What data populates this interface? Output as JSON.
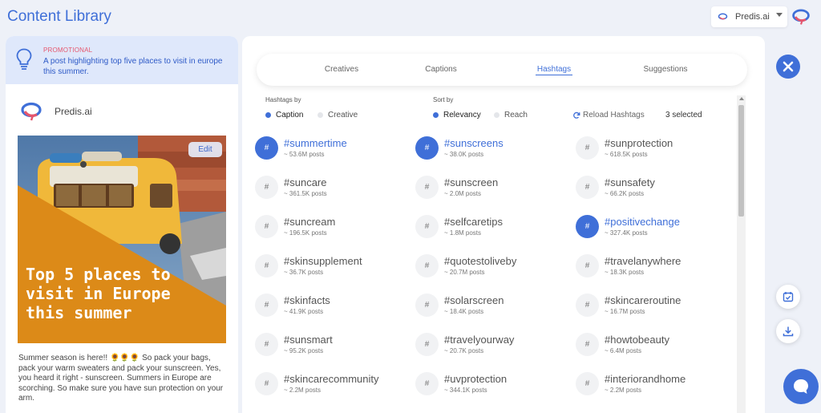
{
  "app": {
    "title": "Content Library"
  },
  "account": {
    "name": "Predis.ai"
  },
  "prompt": {
    "tag": "PROMOTIONAL",
    "text": "A post highlighting top five places to visit in europe this summer."
  },
  "post": {
    "brand": "Predis.ai",
    "headline_lines": [
      "Top 5 places to",
      "visit in Europe",
      "this summer"
    ],
    "edit_label": "Edit",
    "caption_before": "Summer season is here!! ",
    "caption_emoji": "🌻🌻🌻",
    "caption_after": " So pack your bags, pack your warm sweaters and pack your sunscreen. Yes, you heard it right - sunscreen. Summers in Europe are scorching. So make sure you have sun protection on your arm."
  },
  "tabs": [
    {
      "label": "Creatives",
      "active": false
    },
    {
      "label": "Captions",
      "active": false
    },
    {
      "label": "Hashtags",
      "active": true
    },
    {
      "label": "Suggestions",
      "active": false
    }
  ],
  "options": {
    "hashtags_by_label": "Hashtags by",
    "hashtags_by": [
      {
        "label": "Caption",
        "selected": true
      },
      {
        "label": "Creative",
        "selected": false
      }
    ],
    "sort_by_label": "Sort by",
    "sort_by": [
      {
        "label": "Relevancy",
        "selected": true
      },
      {
        "label": "Reach",
        "selected": false
      }
    ],
    "reload_label": "Reload Hashtags",
    "selected_count": "3 selected"
  },
  "hashtags": [
    {
      "tag": "#summertime",
      "posts": "~ 53.6M posts",
      "selected": true
    },
    {
      "tag": "#sunscreens",
      "posts": "~ 38.0K posts",
      "selected": true
    },
    {
      "tag": "#sunprotection",
      "posts": "~ 618.5K posts",
      "selected": false
    },
    {
      "tag": "#suncare",
      "posts": "~ 361.5K posts",
      "selected": false
    },
    {
      "tag": "#sunscreen",
      "posts": "~ 2.0M posts",
      "selected": false
    },
    {
      "tag": "#sunsafety",
      "posts": "~ 66.2K posts",
      "selected": false
    },
    {
      "tag": "#suncream",
      "posts": "~ 196.5K posts",
      "selected": false
    },
    {
      "tag": "#selfcaretips",
      "posts": "~ 1.8M posts",
      "selected": false
    },
    {
      "tag": "#positivechange",
      "posts": "~ 327.4K posts",
      "selected": true
    },
    {
      "tag": "#skinsupplement",
      "posts": "~ 36.7K posts",
      "selected": false
    },
    {
      "tag": "#quotestoliveby",
      "posts": "~ 20.7M posts",
      "selected": false
    },
    {
      "tag": "#travelanywhere",
      "posts": "~ 18.3K posts",
      "selected": false
    },
    {
      "tag": "#skinfacts",
      "posts": "~ 41.9K posts",
      "selected": false
    },
    {
      "tag": "#solarscreen",
      "posts": "~ 18.4K posts",
      "selected": false
    },
    {
      "tag": "#skincareroutine",
      "posts": "~ 16.7M posts",
      "selected": false
    },
    {
      "tag": "#sunsmart",
      "posts": "~ 95.2K posts",
      "selected": false
    },
    {
      "tag": "#travelyourway",
      "posts": "~ 20.7K posts",
      "selected": false
    },
    {
      "tag": "#howtobeauty",
      "posts": "~ 6.4M posts",
      "selected": false
    },
    {
      "tag": "#skincarecommunity",
      "posts": "~ 2.2M posts",
      "selected": false
    },
    {
      "tag": "#uvprotection",
      "posts": "~ 344.1K posts",
      "selected": false
    },
    {
      "tag": "#interiorandhome",
      "posts": "~ 2.2M posts",
      "selected": false
    }
  ],
  "hash_symbol": "#",
  "colors": {
    "accent": "#3f6fd8",
    "promo_tag": "#e6566d",
    "creative_orange": "#dc8a18",
    "promo_bg": "#dfe8fb"
  },
  "icons": [
    "lightbulb-icon",
    "predis-logo-icon",
    "caret-down-icon",
    "reload-icon",
    "close-icon",
    "calendar-check-icon",
    "download-icon",
    "chat-icon"
  ]
}
